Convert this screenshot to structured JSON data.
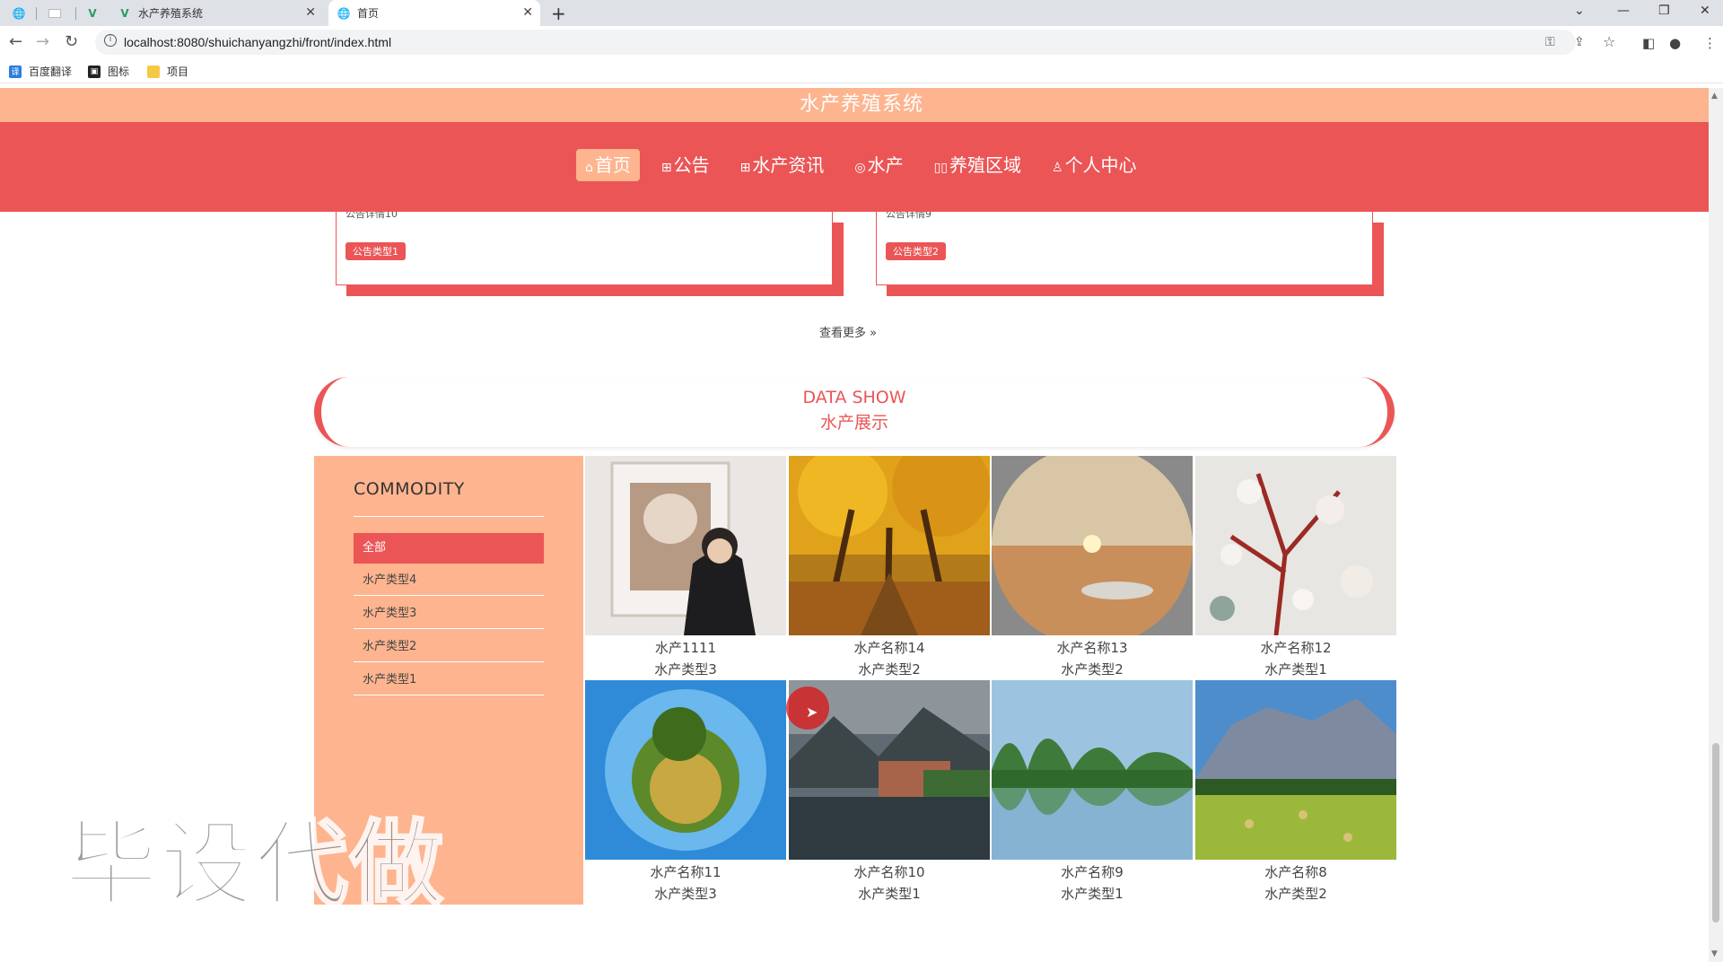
{
  "browser": {
    "tabs": [
      {
        "title": ""
      },
      {
        "title": ""
      },
      {
        "title": ""
      },
      {
        "title": "水产养殖系统"
      },
      {
        "title": "首页"
      }
    ],
    "url": "localhost:8080/shuichanyangzhi/front/index.html",
    "bookmarks": [
      {
        "label": "百度翻译",
        "icon": "translate-icon"
      },
      {
        "label": "图标",
        "icon": "image-icon"
      },
      {
        "label": "项目",
        "icon": "folder-icon"
      }
    ]
  },
  "site": {
    "title": "水产养殖系统",
    "nav": [
      {
        "label": "首页",
        "icon": "home-icon",
        "glyph": "⌂",
        "active": true
      },
      {
        "label": "公告",
        "icon": "gift-icon",
        "glyph": "⊞",
        "active": false
      },
      {
        "label": "水产资讯",
        "icon": "grid-icon",
        "glyph": "⊞",
        "active": false
      },
      {
        "label": "水产",
        "icon": "dial-icon",
        "glyph": "◎",
        "active": false
      },
      {
        "label": "养殖区域",
        "icon": "columns-icon",
        "glyph": "▯",
        "active": false
      },
      {
        "label": "个人中心",
        "icon": "user-icon",
        "glyph": "♙",
        "active": false
      }
    ]
  },
  "notices": [
    {
      "text": "公告详情10",
      "tag": "公告类型1"
    },
    {
      "text": "公告详情9",
      "tag": "公告类型2"
    }
  ],
  "more_link": "查看更多",
  "section": {
    "en": "DATA SHOW",
    "cn": "水产展示"
  },
  "categories": {
    "title": "COMMODITY",
    "items": [
      {
        "label": "全部",
        "active": true
      },
      {
        "label": "水产类型4",
        "active": false
      },
      {
        "label": "水产类型3",
        "active": false
      },
      {
        "label": "水产类型2",
        "active": false
      },
      {
        "label": "水产类型1",
        "active": false
      }
    ]
  },
  "products": [
    {
      "name": "水产1111",
      "type": "水产类型3",
      "image": "person-in-gallery"
    },
    {
      "name": "水产名称14",
      "type": "水产类型2",
      "image": "autumn-trees"
    },
    {
      "name": "水产名称13",
      "type": "水产类型2",
      "image": "desert-sunset"
    },
    {
      "name": "水产名称12",
      "type": "水产类型1",
      "image": "blossom-branch"
    },
    {
      "name": "水产名称11",
      "type": "水产类型3",
      "image": "tiny-planet"
    },
    {
      "name": "水产名称10",
      "type": "水产类型1",
      "image": "lake-village"
    },
    {
      "name": "水产名称9",
      "type": "水产类型1",
      "image": "karst-river"
    },
    {
      "name": "水产名称8",
      "type": "水产类型2",
      "image": "mountain-meadow"
    }
  ],
  "watermark": "毕设代做",
  "colors": {
    "primary": "#eb5556",
    "secondary": "#fdb48f"
  }
}
